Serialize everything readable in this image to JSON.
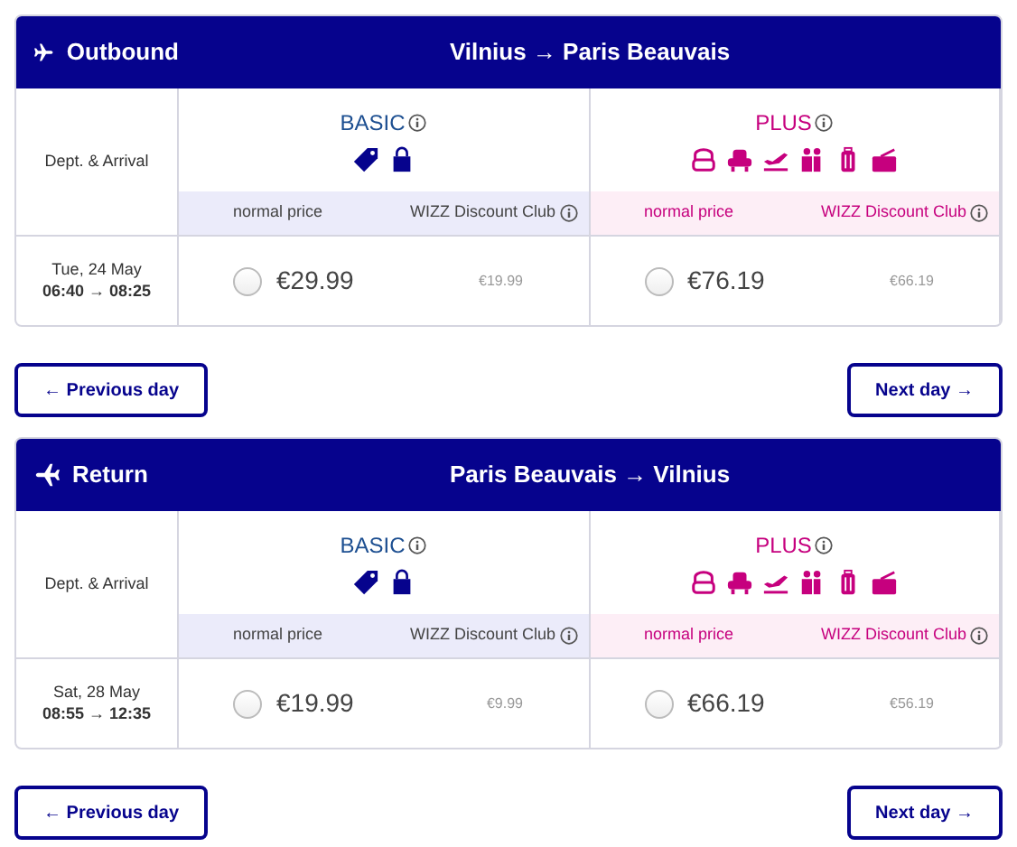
{
  "flights": [
    {
      "kind": "outbound",
      "label": "Outbound",
      "route": "Vilnius → Paris Beauvais",
      "dept_label": "Dept. & Arrival",
      "date": "Tue, 24 May",
      "times": "06:40 → 08:25",
      "fares": [
        {
          "kind": "basic",
          "name": "BASIC",
          "normal_label": "normal price",
          "club_label": "WIZZ Discount Club",
          "price": "€29.99",
          "club_price": "€19.99",
          "selected": false
        },
        {
          "kind": "plus",
          "name": "PLUS",
          "normal_label": "normal price",
          "club_label": "WIZZ Discount Club",
          "price": "€76.19",
          "club_price": "€66.19",
          "selected": false
        }
      ],
      "prev_button": "← Previous day",
      "next_button": "Next day →"
    },
    {
      "kind": "return",
      "label": "Return",
      "route": "Paris Beauvais → Vilnius",
      "dept_label": "Dept. & Arrival",
      "date": "Sat, 28 May",
      "times": "08:55 → 12:35",
      "fares": [
        {
          "kind": "basic",
          "name": "BASIC",
          "normal_label": "normal price",
          "club_label": "WIZZ Discount Club",
          "price": "€19.99",
          "club_price": "€9.99",
          "selected": false
        },
        {
          "kind": "plus",
          "name": "PLUS",
          "normal_label": "normal price",
          "club_label": "WIZZ Discount Club",
          "price": "€66.19",
          "club_price": "€56.19",
          "selected": false
        }
      ],
      "prev_button": "← Previous day",
      "next_button": "Next day →"
    }
  ]
}
